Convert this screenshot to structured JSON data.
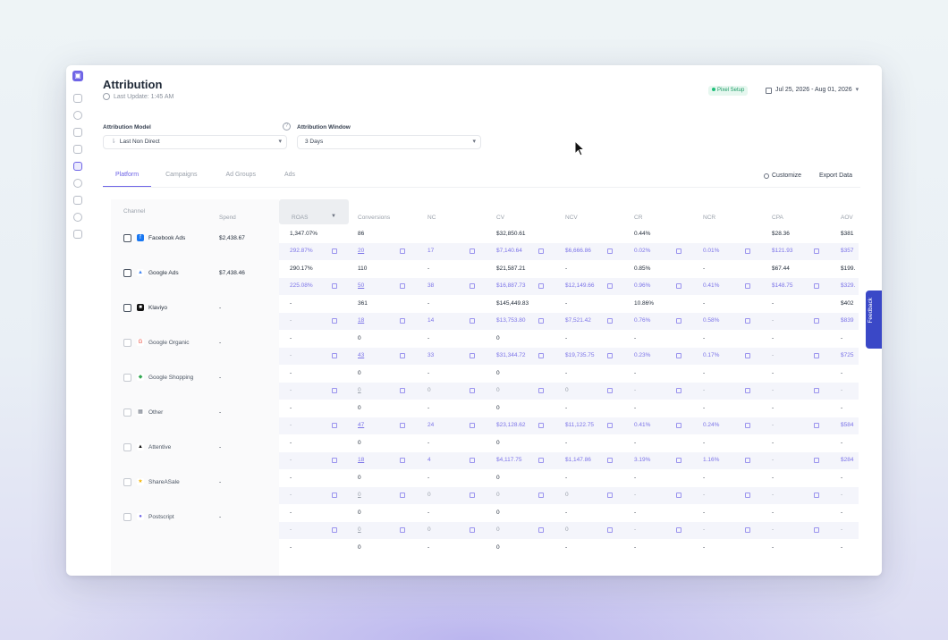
{
  "page": {
    "title": "Attribution",
    "last_updated": "Last Update: 1:45 AM",
    "pixel_status": "Pixel Setup",
    "date_range": "Jul 25, 2026 - Aug 01, 2026"
  },
  "model": {
    "label": "Attribution Model",
    "value": "Last Non Direct"
  },
  "window": {
    "label": "Attribution Window",
    "value": "3 Days"
  },
  "tabs": [
    "Platform",
    "Campaigns",
    "Ad Groups",
    "Ads"
  ],
  "actions": {
    "customize": "Customize",
    "export": "Export Data"
  },
  "headers": {
    "channel": "Channel",
    "spend": "Spend",
    "roas": "ROAS",
    "conversions": "Conversions",
    "nc": "NC",
    "cv": "CV",
    "ncv": "NCV",
    "cr": "CR",
    "ncr": "NCR",
    "cpa": "CPA",
    "aov": "AOV"
  },
  "channels": [
    {
      "name": "Facebook Ads",
      "spend": "$2,438.67"
    },
    {
      "name": "Google Ads",
      "spend": "$7,438.46"
    },
    {
      "name": "Klaviyo",
      "spend": "-"
    },
    {
      "name": "Google Organic",
      "spend": "-"
    },
    {
      "name": "Google Shopping",
      "spend": "-"
    },
    {
      "name": "Other",
      "spend": "-"
    },
    {
      "name": "Attentive",
      "spend": "-"
    },
    {
      "name": "ShareASale",
      "spend": "-"
    },
    {
      "name": "Postscript",
      "spend": "-"
    }
  ],
  "rows": [
    {
      "main": [
        "1,347.07%",
        "86",
        "",
        "$32,850.61",
        "",
        "0.44%",
        "",
        "$28.36",
        "$381"
      ],
      "sub": [
        "292.87%",
        "20",
        "17",
        "$7,140.64",
        "$6,666.86",
        "0.02%",
        "0.01%",
        "$121.93",
        "$357"
      ]
    },
    {
      "main": [
        "290.17%",
        "110",
        "-",
        "$21,587.21",
        "-",
        "0.85%",
        "-",
        "$67.44",
        "$199."
      ],
      "sub": [
        "225.08%",
        "50",
        "38",
        "$16,887.73",
        "$12,149.66",
        "0.96%",
        "0.41%",
        "$148.75",
        "$329."
      ]
    },
    {
      "main": [
        "-",
        "361",
        "-",
        "$145,449.83",
        "-",
        "10.86%",
        "-",
        "-",
        "$402"
      ],
      "sub": [
        "-",
        "18",
        "14",
        "$13,753.80",
        "$7,521.42",
        "0.76%",
        "0.58%",
        "-",
        "$839"
      ]
    },
    {
      "main": [
        "-",
        "0",
        "-",
        "0",
        "-",
        "-",
        "-",
        "-",
        "-"
      ],
      "sub": [
        "-",
        "43",
        "33",
        "$31,344.72",
        "$19,735.75",
        "0.23%",
        "0.17%",
        "-",
        "$725"
      ]
    },
    {
      "main": [
        "-",
        "0",
        "-",
        "0",
        "-",
        "-",
        "-",
        "-",
        "-"
      ],
      "sub": [
        "-",
        "0",
        "0",
        "0",
        "0",
        "-",
        "-",
        "-",
        "-"
      ]
    },
    {
      "main": [
        "-",
        "0",
        "-",
        "0",
        "-",
        "-",
        "-",
        "-",
        "-"
      ],
      "sub": [
        "-",
        "47",
        "24",
        "$23,128.62",
        "$11,122.75",
        "0.41%",
        "0.24%",
        "-",
        "$584"
      ]
    },
    {
      "main": [
        "-",
        "0",
        "-",
        "0",
        "-",
        "-",
        "-",
        "-",
        "-"
      ],
      "sub": [
        "-",
        "18",
        "4",
        "$4,117.75",
        "$1,147.86",
        "3.19%",
        "1.16%",
        "-",
        "$284"
      ]
    },
    {
      "main": [
        "-",
        "0",
        "-",
        "0",
        "-",
        "-",
        "-",
        "-",
        "-"
      ],
      "sub": [
        "-",
        "0",
        "0",
        "0",
        "0",
        "-",
        "-",
        "-",
        "-"
      ]
    },
    {
      "main": [
        "-",
        "0",
        "-",
        "0",
        "-",
        "-",
        "-",
        "-",
        "-"
      ],
      "sub": [
        "-",
        "0",
        "0",
        "0",
        "0",
        "-",
        "-",
        "-",
        "-"
      ]
    },
    {
      "main": [
        "-",
        "0",
        "-",
        "0",
        "-",
        "-",
        "-",
        "-",
        "-"
      ],
      "sub": []
    }
  ],
  "feedback": "Feedback"
}
